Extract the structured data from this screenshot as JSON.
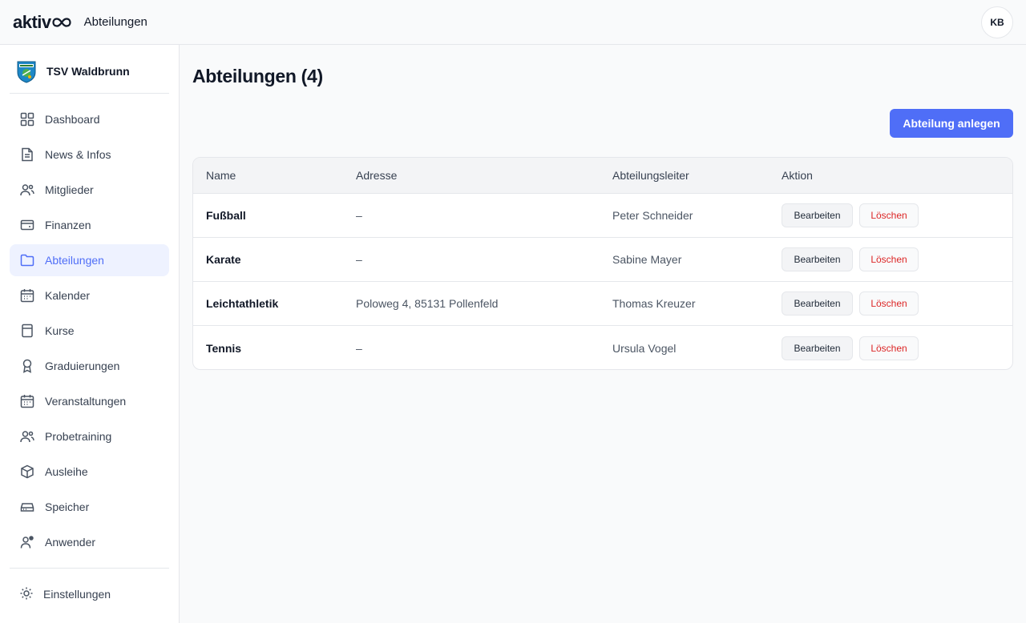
{
  "app": {
    "logo_text": "aktiv",
    "title": "Abteilungen",
    "user_initials": "KB"
  },
  "sidebar": {
    "club_name": "TSV Waldbrunn",
    "items": [
      {
        "label": "Dashboard",
        "icon": "grid-icon"
      },
      {
        "label": "News & Infos",
        "icon": "document-icon"
      },
      {
        "label": "Mitglieder",
        "icon": "users-icon"
      },
      {
        "label": "Finanzen",
        "icon": "wallet-icon"
      },
      {
        "label": "Abteilungen",
        "icon": "folder-icon",
        "active": true
      },
      {
        "label": "Kalender",
        "icon": "calendar-icon"
      },
      {
        "label": "Kurse",
        "icon": "book-icon"
      },
      {
        "label": "Graduierungen",
        "icon": "award-icon"
      },
      {
        "label": "Veranstaltungen",
        "icon": "calendar-icon"
      },
      {
        "label": "Probetraining",
        "icon": "users-icon"
      },
      {
        "label": "Ausleihe",
        "icon": "box-icon"
      },
      {
        "label": "Speicher",
        "icon": "storage-icon"
      },
      {
        "label": "Anwender",
        "icon": "user-settings-icon"
      }
    ],
    "settings_label": "Einstellungen"
  },
  "main": {
    "page_title": "Abteilungen (4)",
    "create_button": "Abteilung anlegen",
    "table": {
      "headers": [
        "Name",
        "Adresse",
        "Abteilungsleiter",
        "Aktion"
      ],
      "rows": [
        {
          "name": "Fußball",
          "address": "–",
          "leader": "Peter Schneider"
        },
        {
          "name": "Karate",
          "address": "–",
          "leader": "Sabine Mayer"
        },
        {
          "name": "Leichtathletik",
          "address": "Poloweg 4, 85131 Pollenfeld",
          "leader": "Thomas Kreuzer"
        },
        {
          "name": "Tennis",
          "address": "–",
          "leader": "Ursula Vogel"
        }
      ],
      "edit_label": "Bearbeiten",
      "delete_label": "Löschen"
    }
  },
  "colors": {
    "accent": "#4f6ef7",
    "danger": "#dc2626",
    "active_bg": "#eef2ff"
  }
}
